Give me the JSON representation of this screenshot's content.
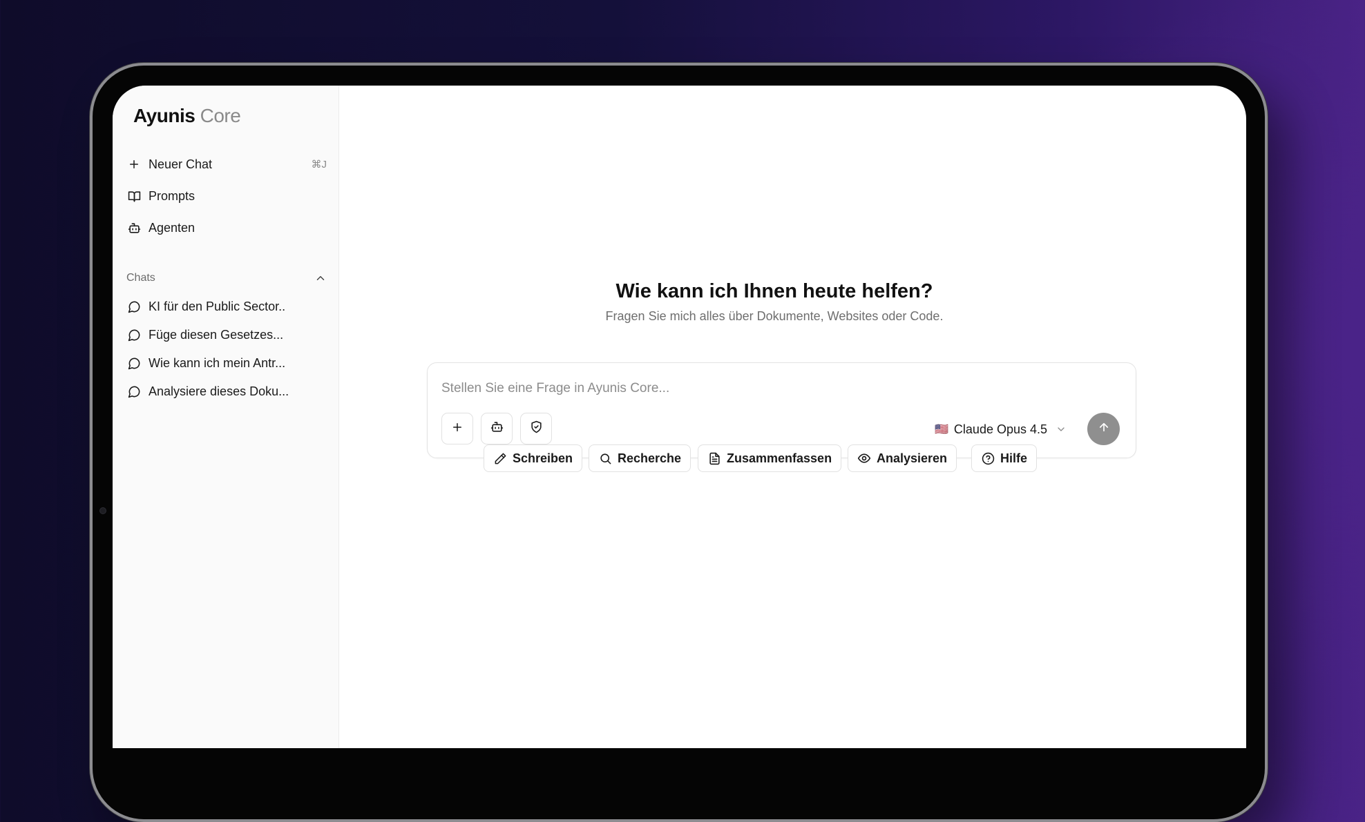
{
  "brand": {
    "name_part1": "Ayunis",
    "name_part2": "Core"
  },
  "sidebar": {
    "nav": [
      {
        "label": "Neuer Chat",
        "icon": "plus-icon",
        "shortcut": "⌘J"
      },
      {
        "label": "Prompts",
        "icon": "book-icon"
      },
      {
        "label": "Agenten",
        "icon": "bot-icon"
      }
    ],
    "chats_section": {
      "title": "Chats",
      "items": [
        {
          "label": "KI für den Public Sector..",
          "icon": "message-circle-icon"
        },
        {
          "label": "Füge diesen Gesetzes...",
          "icon": "message-circle-icon"
        },
        {
          "label": "Wie kann ich mein Antr...",
          "icon": "message-circle-icon"
        },
        {
          "label": "Analysiere dieses Doku...",
          "icon": "message-circle-icon"
        }
      ]
    }
  },
  "main": {
    "headline": "Wie kann ich Ihnen heute helfen?",
    "subline": "Fragen Sie mich alles über Dokumente, Websites oder Code.",
    "composer": {
      "placeholder": "Stellen Sie eine Frage in Ayunis Core...",
      "value": "",
      "tools": [
        "plus-icon",
        "bot-icon",
        "shield-check-icon"
      ],
      "model": {
        "flag": "🇺🇸",
        "name": "Claude Opus 4.5"
      }
    },
    "suggestions": [
      {
        "label": "Schreiben",
        "icon": "pencil-icon"
      },
      {
        "label": "Recherche",
        "icon": "search-icon"
      },
      {
        "label": "Zusammenfassen",
        "icon": "file-text-icon"
      },
      {
        "label": "Analysieren",
        "icon": "eye-icon"
      },
      {
        "label": "Hilfe",
        "icon": "help-circle-icon"
      }
    ]
  },
  "colors": {
    "background_dark": "#0f0c2a",
    "background_purple": "#4a2386",
    "send_button": "#8f8f8f",
    "sidebar_bg": "#fafafa"
  }
}
